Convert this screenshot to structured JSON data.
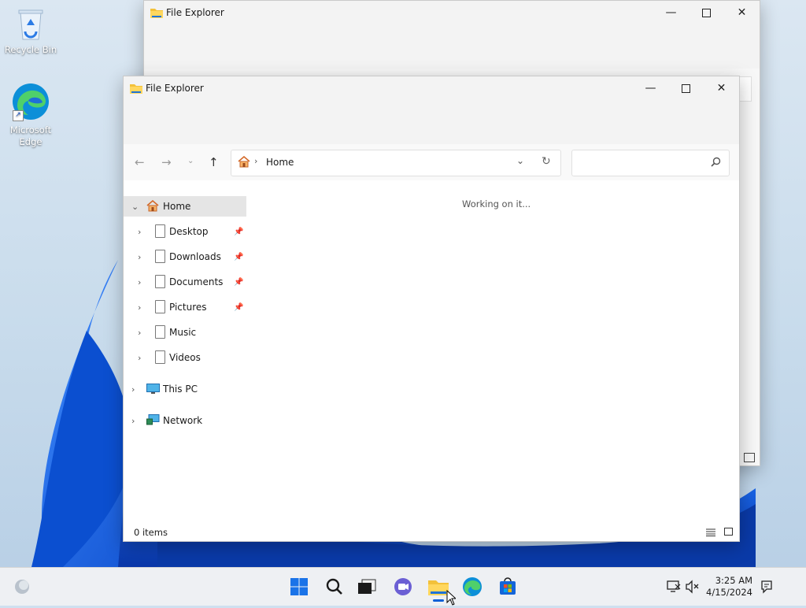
{
  "desktop": {
    "icons": [
      {
        "label": "Recycle Bin",
        "icon": "recycle-bin-icon"
      },
      {
        "label": "Microsoft Edge",
        "icon": "edge-icon"
      }
    ]
  },
  "back_window": {
    "title": "File Explorer"
  },
  "front_window": {
    "title": "File Explorer",
    "address": {
      "path": "Home"
    },
    "search": {
      "placeholder": ""
    },
    "sidebar": {
      "home": "Home",
      "quick_access": [
        {
          "label": "Desktop",
          "pinned": true
        },
        {
          "label": "Downloads",
          "pinned": true
        },
        {
          "label": "Documents",
          "pinned": true
        },
        {
          "label": "Pictures",
          "pinned": true
        },
        {
          "label": "Music",
          "pinned": false
        },
        {
          "label": "Videos",
          "pinned": false
        }
      ],
      "this_pc": "This PC",
      "network": "Network"
    },
    "content": {
      "message": "Working on it..."
    },
    "status": {
      "items": "0 items"
    }
  },
  "taskbar": {
    "apps": [
      "start-icon",
      "search-icon",
      "task-view-icon",
      "chat-icon",
      "file-explorer-icon",
      "edge-icon",
      "store-icon"
    ],
    "clock": {
      "time": "3:25 AM",
      "date": "4/15/2024"
    }
  },
  "colors": {
    "accent": "#0a5fd7",
    "folder": "#f3c13a",
    "selected": "#e5e5e5"
  }
}
